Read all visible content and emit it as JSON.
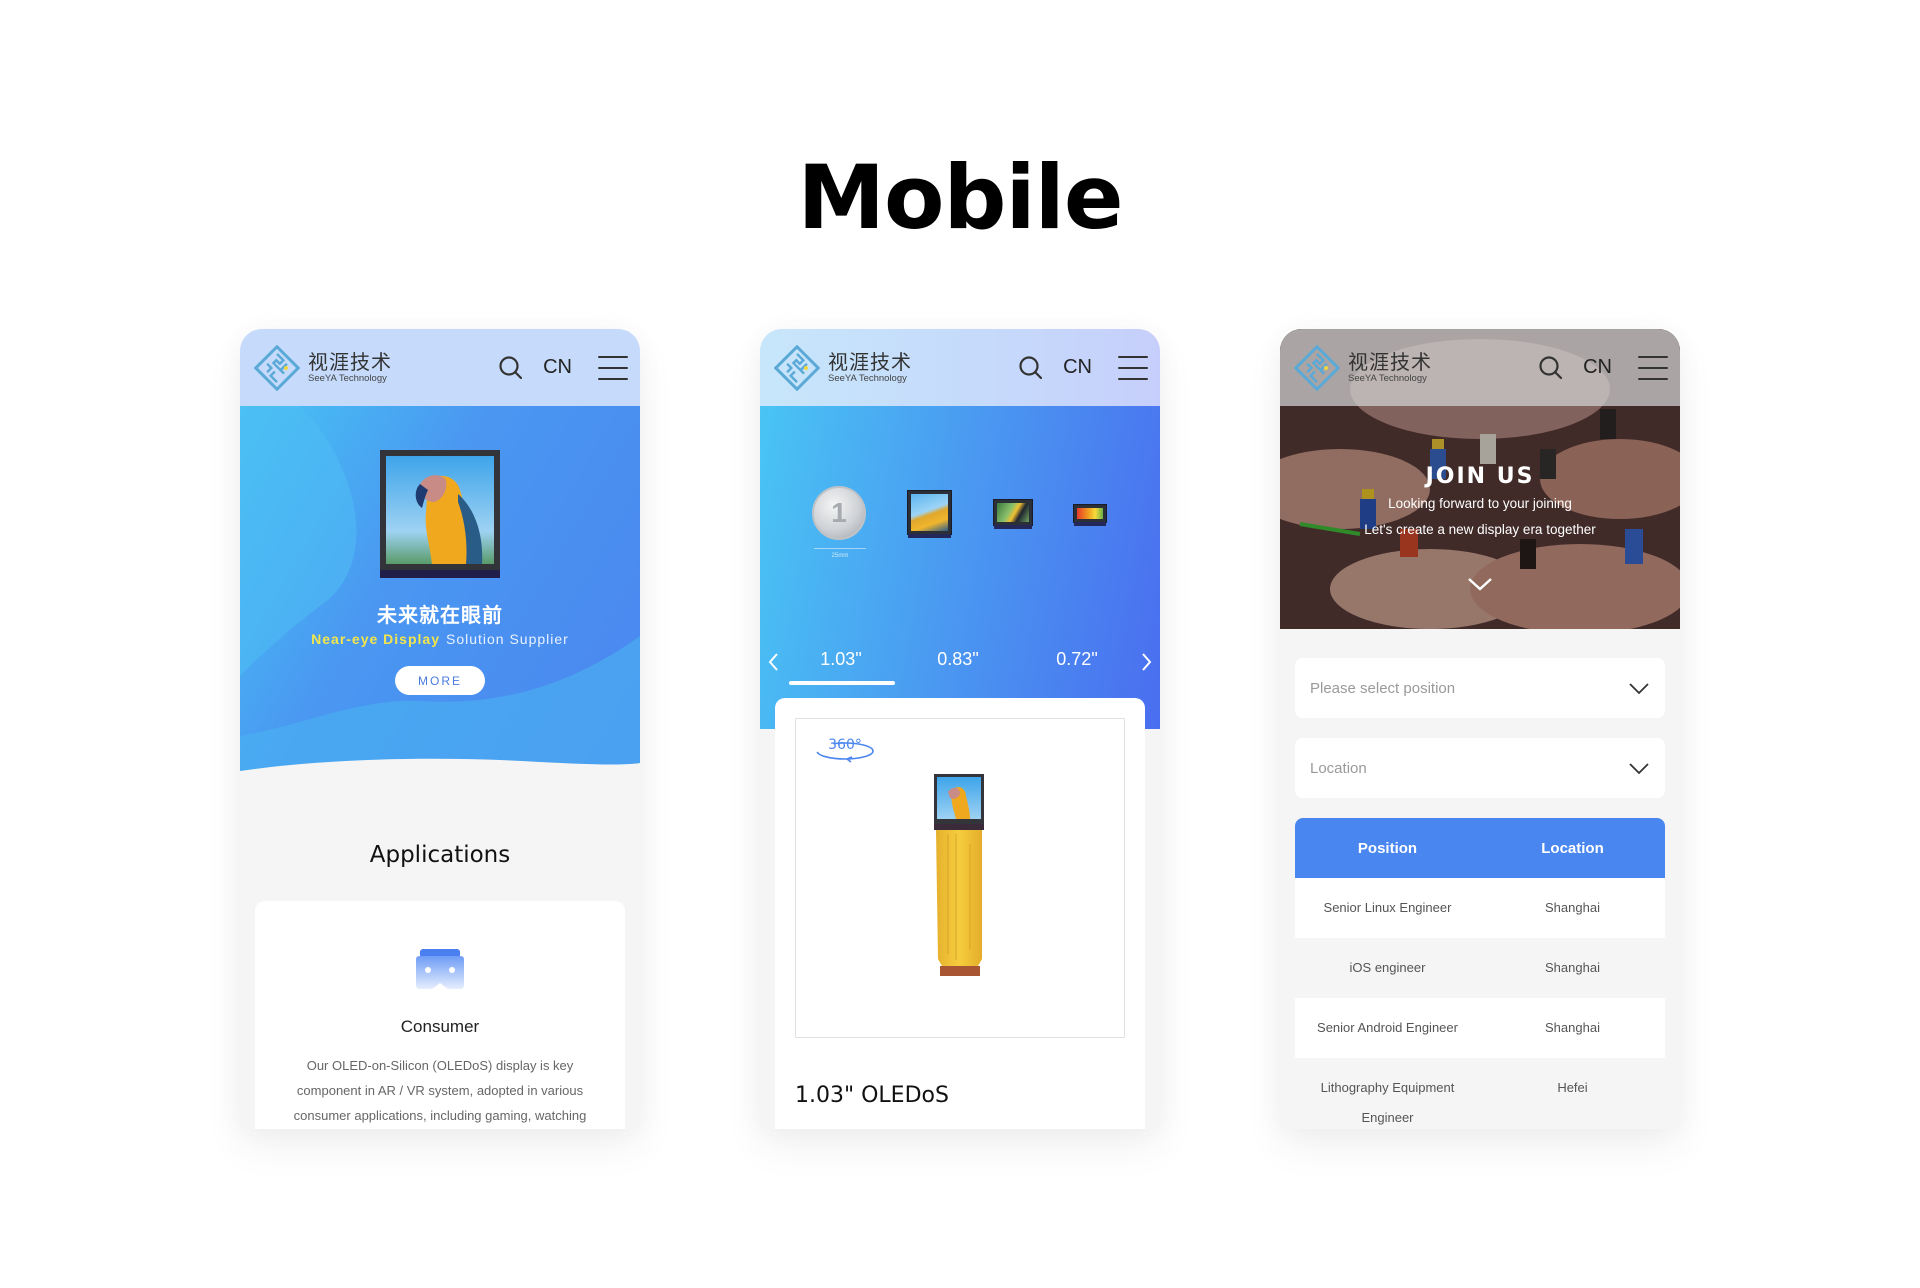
{
  "page": {
    "title": "Mobile"
  },
  "header": {
    "brand_cn": "视涯技术",
    "brand_en": "SeeYA Technology",
    "lang": "CN",
    "search_icon": "search-icon",
    "menu_icon": "hamburger-menu-icon"
  },
  "home": {
    "hero_title": "未来就在眼前",
    "hero_sub_highlight": "Near-eye Display",
    "hero_sub_rest": "Solution Supplier",
    "more_button": "MORE",
    "section_title": "Applications",
    "card": {
      "icon": "vr-headset-icon",
      "title": "Consumer",
      "description": "Our OLED-on-Silicon (OLEDoS) display is key component in AR / VR system, adopted in various consumer applications, including gaming, watching"
    }
  },
  "products": {
    "coin_label": "25mm",
    "coin_glyph": "1",
    "sizes": [
      "1.03\"",
      "0.83\"",
      "0.72\""
    ],
    "active_size_index": 0,
    "badge_360": "360°",
    "product_name": "1.03\" OLEDoS"
  },
  "careers": {
    "hero_title": "JOIN US",
    "hero_line1": "Looking forward to your joining",
    "hero_line2": "Let's create a new display era together",
    "position_placeholder": "Please select position",
    "location_placeholder": "Location",
    "table": {
      "headers": [
        "Position",
        "Location"
      ],
      "rows": [
        [
          "Senior Linux Engineer",
          "Shanghai"
        ],
        [
          "iOS engineer",
          "Shanghai"
        ],
        [
          "Senior Android Engineer",
          "Shanghai"
        ],
        [
          "Lithography Equipment Engineer",
          "Hefei"
        ]
      ]
    }
  },
  "colors": {
    "accent_blue": "#4a86f0",
    "highlight_yellow": "#f3e64a",
    "header_tint": "#c6dbfb"
  }
}
